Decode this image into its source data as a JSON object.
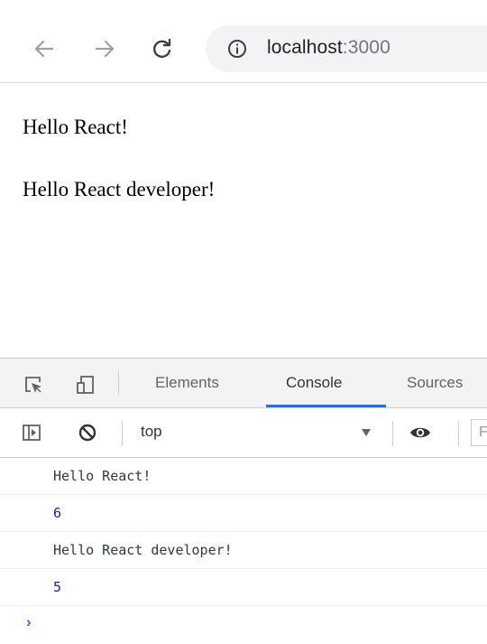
{
  "browser": {
    "url_host": "localhost",
    "url_port": ":3000"
  },
  "page": {
    "lines": [
      "Hello React!",
      "Hello React developer!"
    ]
  },
  "devtools": {
    "tabs": [
      "Elements",
      "Console",
      "Sources"
    ],
    "active_tab": "Console",
    "context": "top",
    "filter_placeholder": "F",
    "messages": [
      {
        "text": "Hello React!",
        "kind": "log"
      },
      {
        "text": "6",
        "kind": "number"
      },
      {
        "text": "Hello React developer!",
        "kind": "log"
      },
      {
        "text": "5",
        "kind": "number"
      }
    ],
    "prompt": "›"
  },
  "colors": {
    "accent": "#1a73e8",
    "number": "#1a1aa6"
  }
}
